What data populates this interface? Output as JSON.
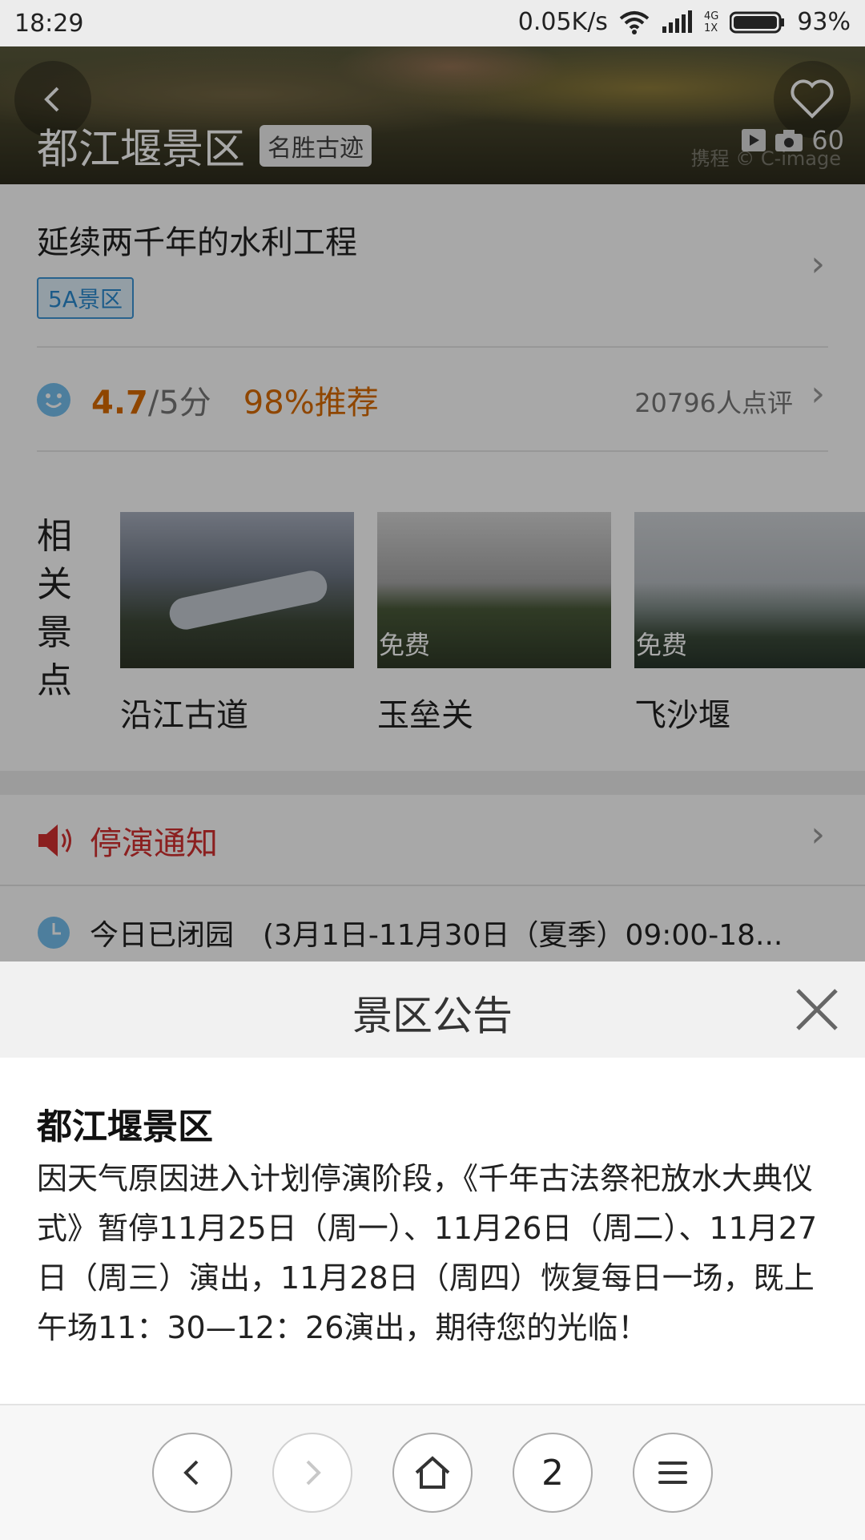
{
  "status_bar": {
    "time": "18:29",
    "speed": "0.05K/s",
    "network_top": "4G",
    "network_bottom": "1X",
    "battery": "93%"
  },
  "hero": {
    "title": "都江堰景区",
    "tag": "名胜古迹",
    "media_count": "60",
    "watermark": "携程 © C-image"
  },
  "summary": {
    "slogan": "延续两千年的水利工程",
    "badge": "5A景区",
    "score": "4.7",
    "score_total": "/5分",
    "recommend": "98%推荐",
    "reviews": "20796人点评"
  },
  "related": {
    "label": "相关景点",
    "items": [
      {
        "name": "沿江古道",
        "free": ""
      },
      {
        "name": "玉垒关",
        "free": "免费"
      },
      {
        "name": "飞沙堰",
        "free": "免费"
      }
    ]
  },
  "notice": {
    "label": "停演通知"
  },
  "hours": {
    "text": "今日已闭园　(3月1日-11月30日（夏季）09:00-18..."
  },
  "sheet": {
    "title": "景区公告",
    "heading": "都江堰景区",
    "body": "因天气原因进入计划停演阶段，《千年古法祭祀放水大典仪式》暂停11月25日（周一）、11月26日（周二）、11月27日（周三）演出，11月28日（周四）恢复每日一场，既上午场11：30—12：26演出，期待您的光临！"
  },
  "nav": {
    "tab_count": "2"
  },
  "colors": {
    "accent_orange": "#d96b00",
    "notice_red": "#d32f2f",
    "badge_blue": "#2a8ad1"
  }
}
